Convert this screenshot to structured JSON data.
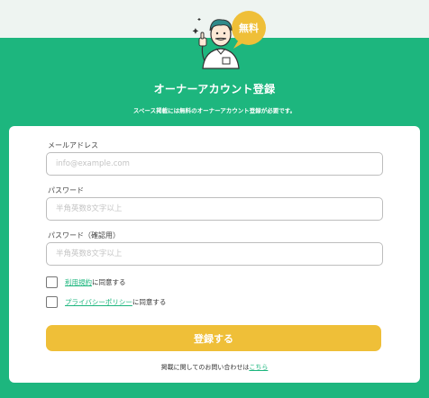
{
  "header": {
    "badge": "無料",
    "title": "オーナーアカウント登録",
    "subtitle": "スペース掲載には無料のオーナーアカウント登録が必要です。"
  },
  "form": {
    "email": {
      "label": "メールアドレス",
      "placeholder": "info@example.com",
      "value": ""
    },
    "password": {
      "label": "パスワード",
      "placeholder": "半角英数8文字以上",
      "value": ""
    },
    "password_confirm": {
      "label": "パスワード（確認用）",
      "placeholder": "半角英数8文字以上",
      "value": ""
    },
    "terms": {
      "link": "利用規約",
      "suffix": "に同意する",
      "checked": false
    },
    "privacy": {
      "link": "プライバシーポリシー",
      "suffix": "に同意する",
      "checked": false
    },
    "submit_label": "登録する"
  },
  "footer": {
    "contact_text": "掲載に関してのお問い合わせは",
    "contact_link": "こちら"
  },
  "colors": {
    "brand_green": "#1db67e",
    "button_yellow": "#efbf38",
    "top_band": "#eef4f1"
  },
  "icons": [
    "mascot-thumbs-up-icon",
    "speech-bubble-badge"
  ]
}
